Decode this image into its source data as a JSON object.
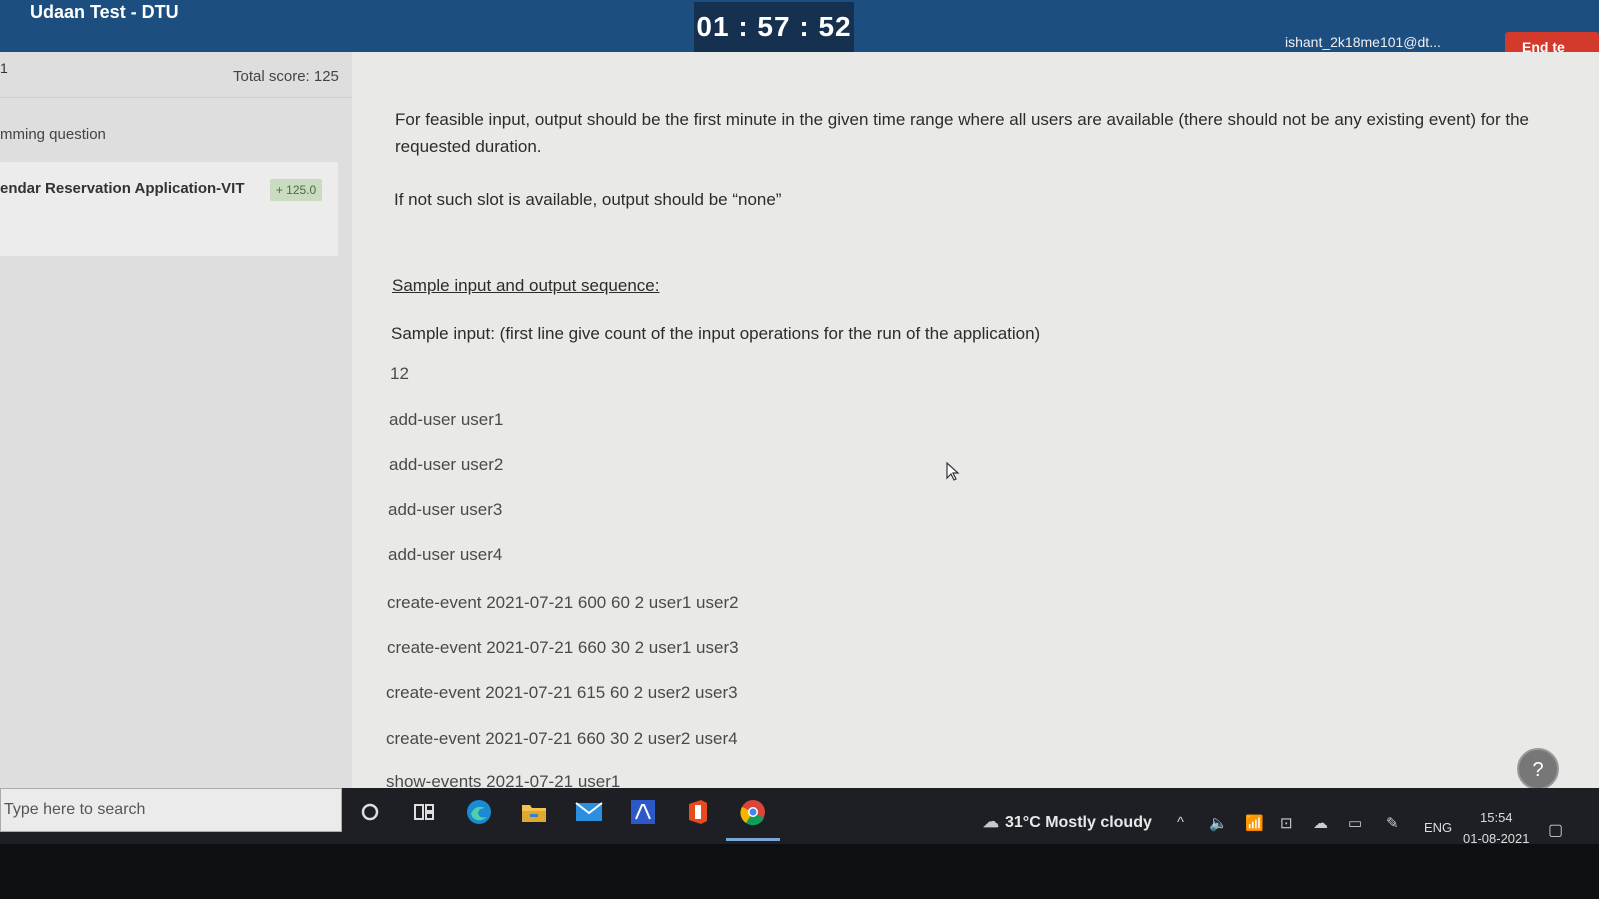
{
  "header": {
    "title": "Udaan Test - DTU",
    "timer": "01 : 57 : 52",
    "user_email": "ishant_2k18me101@dt...",
    "end_button": "End te"
  },
  "sidebar": {
    "section_num": "1",
    "total_score": "Total score: 125",
    "question_type": "mming question",
    "question": {
      "title": "endar Reservation Application-VIT",
      "score": "+ 125.0"
    }
  },
  "main": {
    "paragraph1": "For feasible input, output should be the first minute in the given time range where all users are available (there should not be any existing event) for the requested duration.",
    "paragraph2": "If not such slot is available, output should be “none”",
    "sample_heading": "Sample input and output sequence:",
    "sample_desc": "Sample input: (first line give count of the input operations for the run of the application)",
    "lines": [
      "12",
      "add-user user1",
      "add-user user2",
      "add-user user3",
      "add-user user4",
      "create-event 2021-07-21 600 60 2 user1 user2",
      "create-event 2021-07-21 660 30 2 user1 user3",
      "create-event 2021-07-21 615 60 2 user2 user3",
      "create-event 2021-07-21 660 30 2 user2 user4",
      "show-events 2021-07-21 user1"
    ],
    "help": "?"
  },
  "taskbar": {
    "search_placeholder": "Type here to search",
    "weather": "31°C  Mostly cloudy",
    "lang": "ENG",
    "time": "15:54",
    "date": "01-08-2021",
    "icons": [
      "cortana-icon",
      "task-view-icon",
      "edge-icon",
      "file-explorer-icon",
      "mail-icon",
      "editor-icon",
      "office-icon",
      "chrome-icon"
    ]
  },
  "colors": {
    "header_bg": "#1c4f80",
    "timer_bg": "#16314f",
    "end_button": "#d33a2c",
    "badge_bg": "#c9dcc1"
  }
}
